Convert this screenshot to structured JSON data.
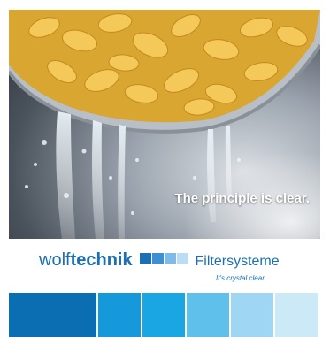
{
  "tagline": "The principle is clear.",
  "brand": {
    "part1": "wolf",
    "part2": "technik",
    "product": "Filtersysteme",
    "slogan": "It's crystal clear."
  },
  "colors": {
    "brand_blue": "#1a6fb5",
    "logo_squares": [
      "#1a6fb5",
      "#3b8fd3",
      "#7fbbe8",
      "#bcdcf4"
    ],
    "bars": [
      "#0b6eb3",
      "#1699db",
      "#1aa5e3",
      "#5fc0ec",
      "#9ed6f4",
      "#cce9f8"
    ]
  },
  "image": {
    "subject": "pasta-in-colander-with-water"
  }
}
